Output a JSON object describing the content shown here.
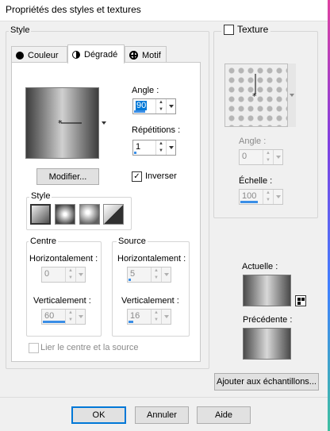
{
  "window": {
    "title": "Propriétés des styles et textures"
  },
  "style_group": {
    "label": "Style",
    "tabs": [
      {
        "label": "Couleur",
        "icon": "circle-icon"
      },
      {
        "label": "Dégradé",
        "icon": "half-circle-icon"
      },
      {
        "label": "Motif",
        "icon": "crosshair-icon"
      }
    ],
    "active_tab": "Dégradé"
  },
  "gradient": {
    "angle_label": "Angle :",
    "angle_value": "90",
    "repetitions_label": "Répétitions :",
    "repetitions_value": "1",
    "modify_button": "Modifier...",
    "invert_label": "Inverser",
    "invert_checked": true,
    "style_label": "Style",
    "style_options": [
      "linear",
      "rectangular",
      "sunburst",
      "radial"
    ],
    "center": {
      "label": "Centre",
      "h_label": "Horizontalement :",
      "h_value": "0",
      "v_label": "Verticalement :",
      "v_value": "60"
    },
    "source": {
      "label": "Source",
      "h_label": "Horizontalement :",
      "h_value": "5",
      "v_label": "Verticalement :",
      "v_value": "16"
    },
    "link_label": "Lier le centre et la source"
  },
  "texture": {
    "label": "Texture",
    "checked": false,
    "angle_label": "Angle :",
    "angle_value": "0",
    "scale_label": "Échelle :",
    "scale_value": "100"
  },
  "swatches": {
    "current_label": "Actuelle :",
    "previous_label": "Précédente :",
    "add_button": "Ajouter aux échantillons..."
  },
  "footer": {
    "ok": "OK",
    "cancel": "Annuler",
    "help": "Aide"
  },
  "colors": {
    "accent": "#0078d7",
    "progress": "#3a8ee6"
  }
}
